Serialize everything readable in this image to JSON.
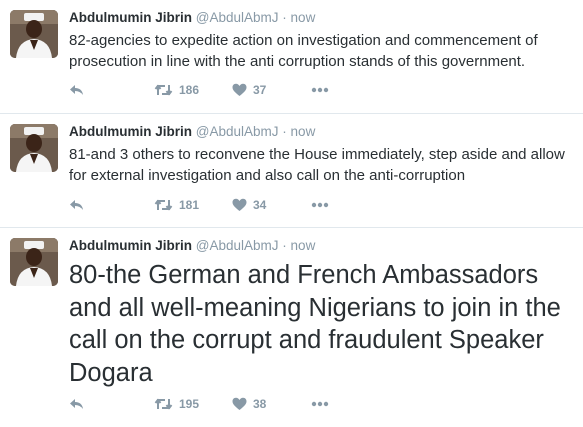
{
  "tweets": [
    {
      "name": "Abdulmumin Jibrin",
      "handle": "@AbdulAbmJ",
      "separator": "·",
      "time": "now",
      "text": "82-agencies to expedite action on investigation and commencement of prosecution in line with the anti corruption stands of this government.",
      "retweets": "186",
      "likes": "37"
    },
    {
      "name": "Abdulmumin Jibrin",
      "handle": "@AbdulAbmJ",
      "separator": "·",
      "time": "now",
      "text": "81-and 3 others to reconvene the House immediately, step aside and allow for external investigation and also call on the anti-corruption",
      "retweets": "181",
      "likes": "34"
    },
    {
      "name": "Abdulmumin Jibrin",
      "handle": "@AbdulAbmJ",
      "separator": "·",
      "time": "now",
      "text": "80-the German and French Ambassadors and all well-meaning Nigerians to join in the call on the corrupt and fraudulent Speaker Dogara",
      "retweets": "195",
      "likes": "38"
    }
  ],
  "icons": {
    "reply": "reply-icon",
    "retweet": "retweet-icon",
    "like": "heart-icon",
    "more": "more-dots-icon"
  },
  "colors": {
    "text": "#292f33",
    "muted": "#8899a6",
    "divider": "#e1e8ed"
  }
}
